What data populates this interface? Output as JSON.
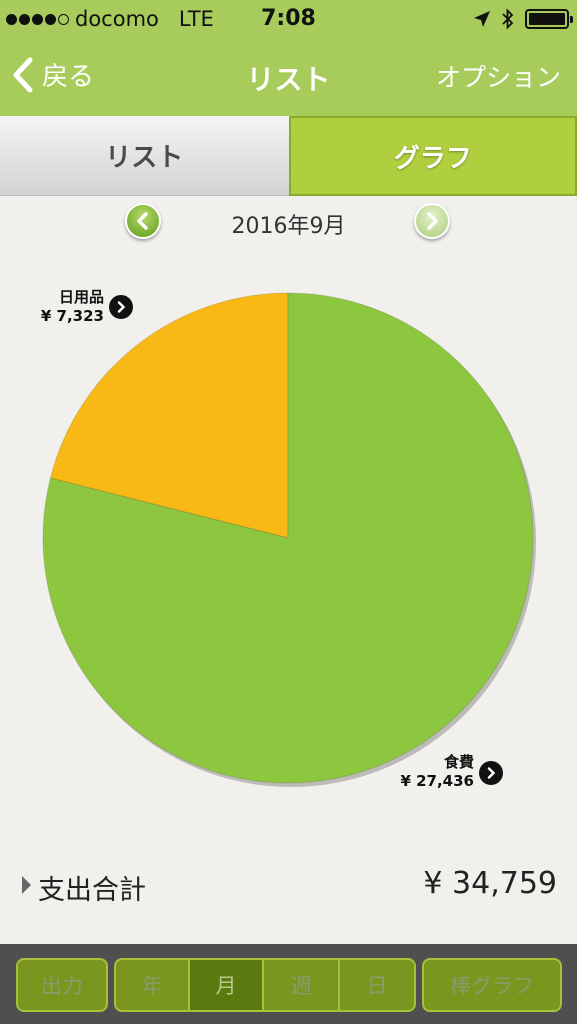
{
  "status_bar": {
    "carrier": "docomo",
    "network": "LTE",
    "time": "7:08",
    "signal_dots_filled": 4,
    "signal_dots_total": 5
  },
  "nav": {
    "back_label": "戻る",
    "title": "リスト",
    "option_label": "オプション"
  },
  "segment": {
    "list_label": "リスト",
    "graph_label": "グラフ",
    "selected": "グラフ"
  },
  "month": {
    "label": "2016年9月"
  },
  "chart_data": {
    "type": "pie",
    "slices": [
      {
        "name": "日用品",
        "value": 7323,
        "value_label": "¥ 7,323",
        "color": "#f8b916"
      },
      {
        "name": "食費",
        "value": 27436,
        "value_label": "¥ 27,436",
        "color": "#8dc63f"
      }
    ],
    "start_angle_deg": 0,
    "direction": "counterclockwise"
  },
  "total": {
    "label": "支出合計",
    "amount": "¥ 34,759"
  },
  "toolbar": {
    "export_label": "出力",
    "year_label": "年",
    "month_label": "月",
    "week_label": "週",
    "day_label": "日",
    "bar_graph_label": "棒グラフ",
    "selected": "月"
  },
  "colors": {
    "header_green": "#a8cc5c",
    "segment_selected": "#afcf3f",
    "toolbar_bg": "#4f4f4f",
    "toolbar_button": "#7a961e",
    "background": "#f2f0ec"
  }
}
